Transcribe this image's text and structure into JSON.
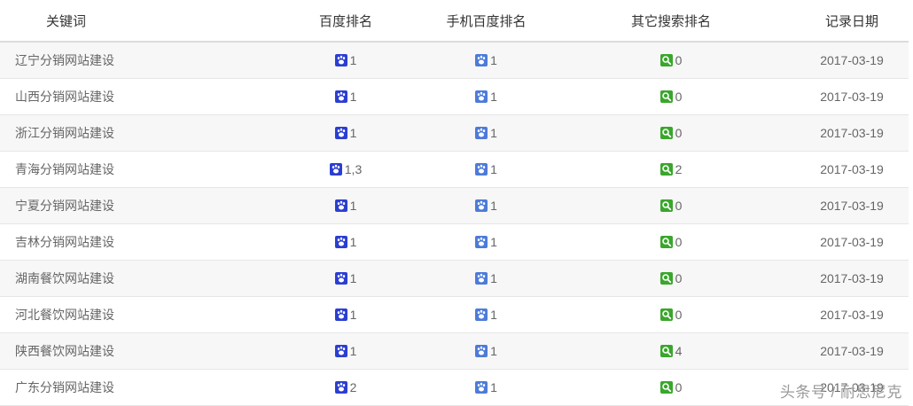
{
  "headers": {
    "keyword": "关键词",
    "baidu": "百度排名",
    "mobile": "手机百度排名",
    "other": "其它搜索排名",
    "date": "记录日期"
  },
  "icons": {
    "baidu": "baidu-paw-icon",
    "mobile": "mobile-baidu-paw-icon",
    "other": "search-magnifier-icon"
  },
  "colors": {
    "baidu": "#2b3ed1",
    "mobile": "#4d7bd8",
    "other": "#3aa62c"
  },
  "rows": [
    {
      "keyword": "辽宁分销网站建设",
      "baidu": "1",
      "mobile": "1",
      "other": "0",
      "date": "2017-03-19"
    },
    {
      "keyword": "山西分销网站建设",
      "baidu": "1",
      "mobile": "1",
      "other": "0",
      "date": "2017-03-19"
    },
    {
      "keyword": "浙江分销网站建设",
      "baidu": "1",
      "mobile": "1",
      "other": "0",
      "date": "2017-03-19"
    },
    {
      "keyword": "青海分销网站建设",
      "baidu": "1,3",
      "mobile": "1",
      "other": "2",
      "date": "2017-03-19"
    },
    {
      "keyword": "宁夏分销网站建设",
      "baidu": "1",
      "mobile": "1",
      "other": "0",
      "date": "2017-03-19"
    },
    {
      "keyword": "吉林分销网站建设",
      "baidu": "1",
      "mobile": "1",
      "other": "0",
      "date": "2017-03-19"
    },
    {
      "keyword": "湖南餐饮网站建设",
      "baidu": "1",
      "mobile": "1",
      "other": "0",
      "date": "2017-03-19"
    },
    {
      "keyword": "河北餐饮网站建设",
      "baidu": "1",
      "mobile": "1",
      "other": "0",
      "date": "2017-03-19"
    },
    {
      "keyword": "陕西餐饮网站建设",
      "baidu": "1",
      "mobile": "1",
      "other": "4",
      "date": "2017-03-19"
    },
    {
      "keyword": "广东分销网站建设",
      "baidu": "2",
      "mobile": "1",
      "other": "0",
      "date": "2017-03-19"
    }
  ],
  "watermark": "头条号 / 耐思尼克"
}
